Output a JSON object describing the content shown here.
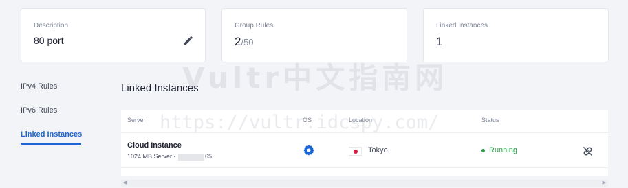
{
  "cards": {
    "description": {
      "label": "Description",
      "value": "80 port"
    },
    "group_rules": {
      "label": "Group Rules",
      "value": "2",
      "max": "/50"
    },
    "linked_instances": {
      "label": "Linked Instances",
      "value": "1"
    }
  },
  "sidebar": {
    "items": [
      {
        "label": "IPv4 Rules"
      },
      {
        "label": "IPv6 Rules"
      },
      {
        "label": "Linked Instances"
      }
    ],
    "active": "Linked Instances"
  },
  "section_title": "Linked Instances",
  "table": {
    "headers": {
      "server": "Server",
      "os": "OS",
      "location": "Location",
      "status": "Status"
    },
    "rows": [
      {
        "server_name": "Cloud Instance",
        "server_detail_prefix": "1024 MB Server -",
        "server_detail_suffix": "65",
        "os_icon": "os-gear-icon",
        "location": "Tokyo",
        "status": "Running",
        "action_icon": "unlink-icon"
      }
    ]
  },
  "watermarks": {
    "main": "Vultr中文指南网",
    "url": "https://vultr.idcspy.com/"
  },
  "colors": {
    "accent": "#1a66d2",
    "status_running": "#2e9c4a",
    "flag_red": "#d31b3f"
  }
}
